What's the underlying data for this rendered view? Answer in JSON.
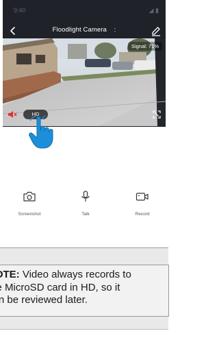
{
  "status_bar": {
    "time": "9:40",
    "signal": "◢ ▮"
  },
  "header": {
    "title": "Floodlight Camera",
    "more": ":"
  },
  "video": {
    "signal_label": "Signal: 71%",
    "quality_label": "HD"
  },
  "controls": [
    {
      "label": "Screenshot"
    },
    {
      "label": "Talk"
    },
    {
      "label": "Record"
    }
  ],
  "note": {
    "prefix": "NOTE:",
    "line1": " Video always records to",
    "line2": "the MicroSD card in HD, so it",
    "line3": "can be reviewed later."
  }
}
